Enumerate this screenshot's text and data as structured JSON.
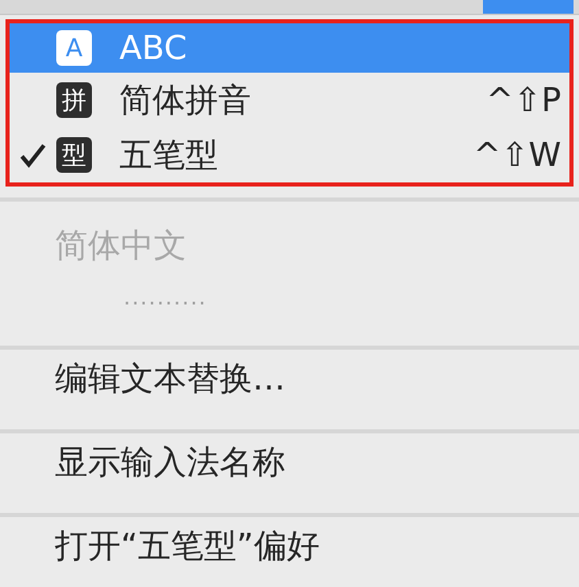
{
  "input_sources": [
    {
      "icon": "A",
      "label": "ABC",
      "selected": true,
      "checked": false
    },
    {
      "icon": "拼",
      "label": "简体拼音",
      "shortcut": "^⇧P",
      "selected": false,
      "checked": false
    },
    {
      "icon": "型",
      "label": "五笔型",
      "shortcut": "^⇧W",
      "selected": false,
      "checked": true
    }
  ],
  "section": {
    "label": "简体中文",
    "disabled": true,
    "detail": ".........."
  },
  "actions": [
    {
      "label": "编辑文本替换…"
    },
    {
      "label": "显示输入法名称"
    },
    {
      "label": "打开“五笔型”偏好"
    }
  ]
}
